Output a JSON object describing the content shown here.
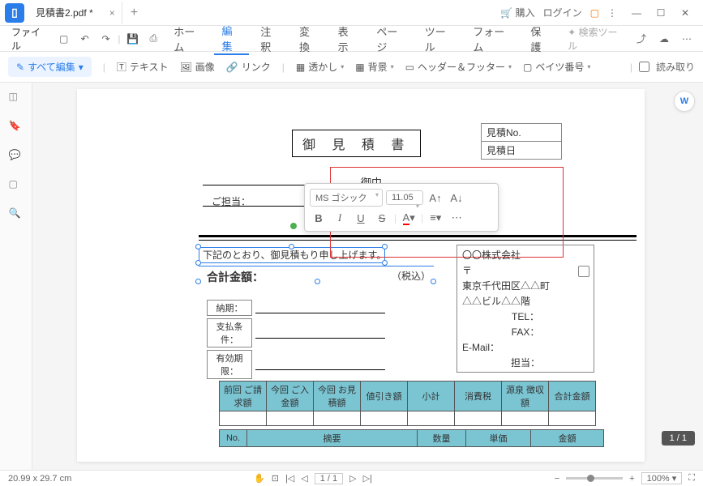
{
  "titlebar": {
    "tab_name": "見積書2.pdf *",
    "buy": "購入",
    "login": "ログイン"
  },
  "menubar": {
    "file": "ファイル",
    "items": [
      "ホーム",
      "編集",
      "注釈",
      "変換",
      "表示",
      "ページ",
      "ツール",
      "フォーム",
      "保護"
    ],
    "search": "検索ツール"
  },
  "toolbar": {
    "edit_all": "すべて編集",
    "text": "テキスト",
    "image": "画像",
    "link": "リンク",
    "watermark": "透かし",
    "background": "背景",
    "header_footer": "ヘッダー＆フッター",
    "bates": "ベイツ番号",
    "readonly": "読み取り"
  },
  "floattb": {
    "font": "MS ゴシック",
    "size": "11.05"
  },
  "doc": {
    "title": "御 見 積 書",
    "est_no": "見積No.",
    "est_date": "見積日",
    "onchu": "御中",
    "gotanto": "ご担当：",
    "kaki": "下記のとおり、御見積もり申し上げます。",
    "gokei": "合計金額：",
    "zeikomi": "（税込）",
    "noki": "納期：",
    "shiharai": "支払条件：",
    "yuko": "有効期限：",
    "company": "〇〇株式会社",
    "postal": "〒",
    "addr1": "東京千代田区△△町",
    "addr2": "△△ビル△△階",
    "tel": "TEL：",
    "fax": "FAX：",
    "email": "E-Mail：",
    "tanto": "担当：",
    "tbl1": [
      "前回\nご請求額",
      "今回\nご入金額",
      "今回\nお見積額",
      "値引き額",
      "小計",
      "消費税",
      "源泉\n徴収額",
      "合計金額"
    ],
    "tbl2": [
      "No.",
      "摘要",
      "数量",
      "単価",
      "金額"
    ]
  },
  "status": {
    "size": "20.99 x 29.7 cm",
    "page": "1 / 1",
    "page_ind": "1 / 1",
    "zoom": "100%"
  }
}
